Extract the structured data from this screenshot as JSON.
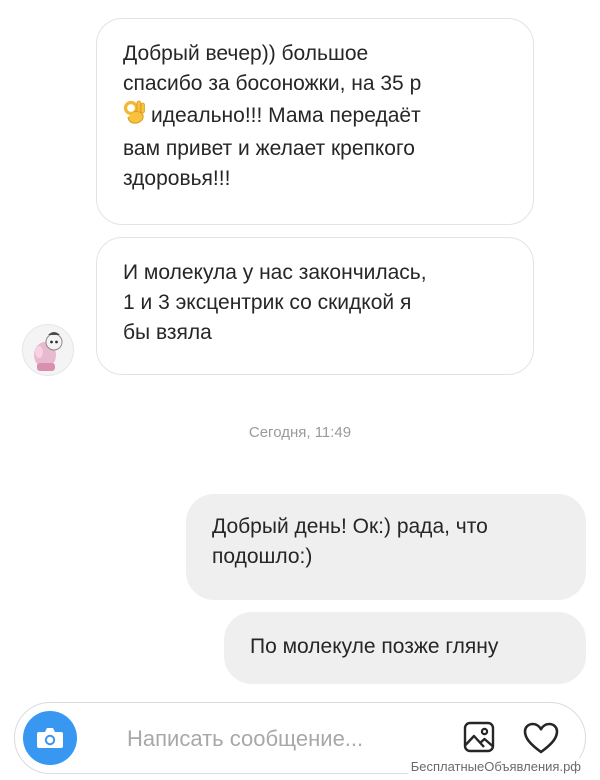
{
  "thread": {
    "messages": [
      {
        "direction": "incoming",
        "line_1": "Добрый вечер)) большое\nспасибо за босоножки, на 35 р",
        "emoji_icon": "ok-hand-emoji",
        "line_2": "идеально!!! Мама передаёт",
        "line_3": "вам привет и желает крепкого\nздоровья!!!"
      },
      {
        "direction": "incoming",
        "text": "И молекула у нас закончилась,\n1 и 3 эксцентрик со скидкой я\nбы  взяла"
      },
      {
        "direction": "outgoing",
        "text": "Добрый день! Ок:) рада, что\nподошло:)"
      },
      {
        "direction": "outgoing",
        "text": "По молекуле позже гляну"
      }
    ],
    "timestamp": "Сегодня, 11:49"
  },
  "composer": {
    "placeholder": "Написать сообщение...",
    "camera_icon": "camera-icon",
    "gallery_icon": "image-icon",
    "like_icon": "heart-icon",
    "accent_color": "#3897f0"
  },
  "watermark": "БесплатныеОбъявления.рф"
}
